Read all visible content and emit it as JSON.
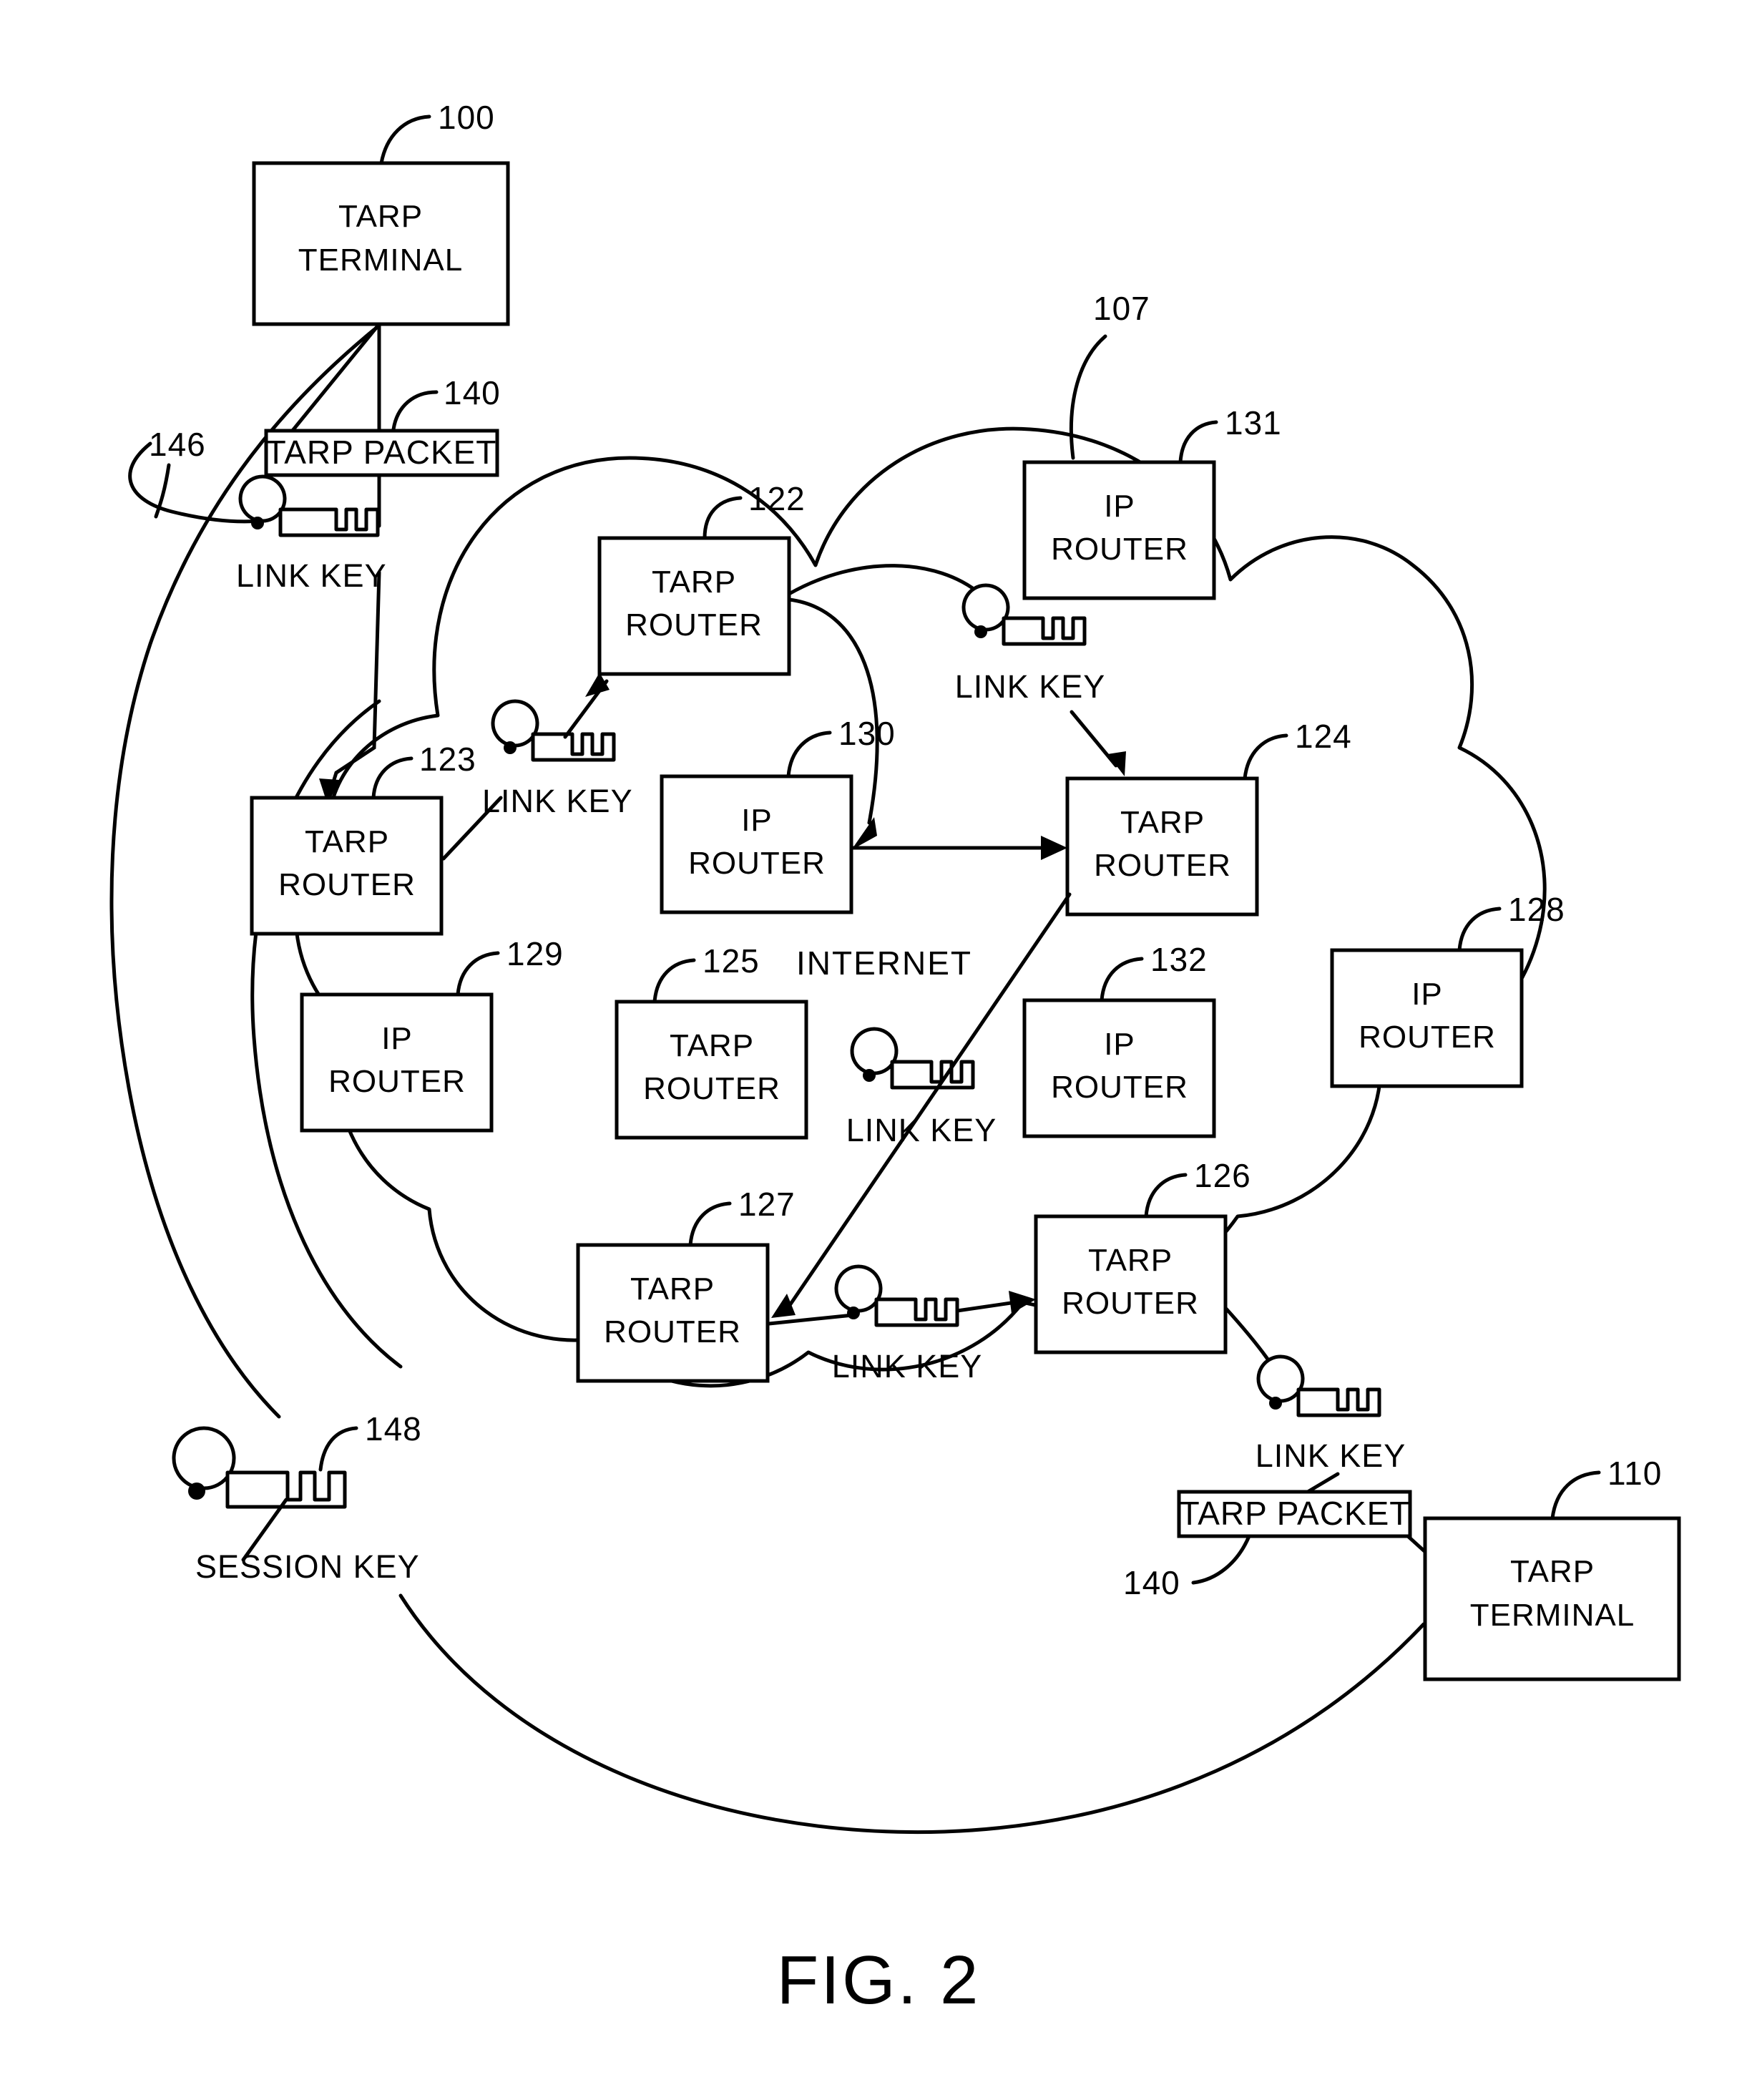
{
  "figure": {
    "caption": "FIG. 2",
    "internet_label": "INTERNET"
  },
  "terminals": [
    {
      "id": "terminal-100",
      "line1": "TARP",
      "line2": "TERMINAL",
      "ref": "100"
    },
    {
      "id": "terminal-110",
      "line1": "TARP",
      "line2": "TERMINAL",
      "ref": "110"
    }
  ],
  "packets": [
    {
      "id": "packet-top",
      "label": "TARP PACKET",
      "ref": "140"
    },
    {
      "id": "packet-bottom",
      "label": "TARP PACKET",
      "ref": "140"
    }
  ],
  "nodes": [
    {
      "id": "tarp-router-122",
      "line1": "TARP",
      "line2": "ROUTER",
      "ref": "122"
    },
    {
      "id": "tarp-router-123",
      "line1": "TARP",
      "line2": "ROUTER",
      "ref": "123"
    },
    {
      "id": "tarp-router-124",
      "line1": "TARP",
      "line2": "ROUTER",
      "ref": "124"
    },
    {
      "id": "tarp-router-125",
      "line1": "TARP",
      "line2": "ROUTER",
      "ref": "125"
    },
    {
      "id": "tarp-router-126",
      "line1": "TARP",
      "line2": "ROUTER",
      "ref": "126"
    },
    {
      "id": "tarp-router-127",
      "line1": "TARP",
      "line2": "ROUTER",
      "ref": "127"
    },
    {
      "id": "ip-router-128",
      "line1": "IP",
      "line2": "ROUTER",
      "ref": "128"
    },
    {
      "id": "ip-router-129",
      "line1": "IP",
      "line2": "ROUTER",
      "ref": "129"
    },
    {
      "id": "ip-router-130",
      "line1": "IP",
      "line2": "ROUTER",
      "ref": "130"
    },
    {
      "id": "ip-router-131",
      "line1": "IP",
      "line2": "ROUTER",
      "ref": "131"
    },
    {
      "id": "ip-router-132",
      "line1": "IP",
      "line2": "ROUTER",
      "ref": "132"
    }
  ],
  "keys": [
    {
      "id": "link-key-146",
      "label": "LINK KEY",
      "ref": "146"
    },
    {
      "id": "link-key-123",
      "label": "LINK KEY",
      "ref": ""
    },
    {
      "id": "link-key-124",
      "label": "LINK KEY",
      "ref": ""
    },
    {
      "id": "link-key-126",
      "label": "LINK KEY",
      "ref": ""
    },
    {
      "id": "link-key-mid",
      "label": "LINK KEY",
      "ref": ""
    },
    {
      "id": "link-key-110",
      "label": "LINK KEY",
      "ref": ""
    },
    {
      "id": "session-key-148",
      "label": "SESSION KEY",
      "ref": "148"
    }
  ],
  "clouds": [
    {
      "id": "internet-cloud",
      "ref": "107"
    }
  ],
  "colors": {
    "ink": "#000000",
    "paper": "#ffffff"
  }
}
